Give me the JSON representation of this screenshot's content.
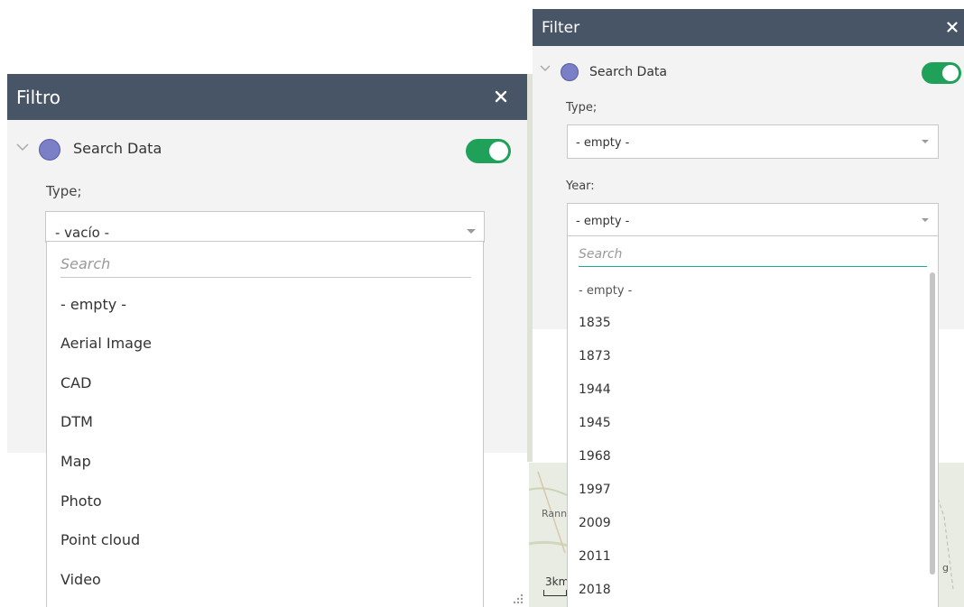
{
  "left_widget": {
    "title": "Filtro",
    "layer": {
      "name": "Search Data",
      "enabled": true
    },
    "field_label": "Type;",
    "select_value": "- vacío -",
    "dropdown": {
      "search_placeholder": "Search",
      "options": [
        "- empty -",
        "Aerial Image",
        "CAD",
        "DTM",
        "Map",
        "Photo",
        "Point cloud",
        "Video"
      ]
    }
  },
  "right_widget": {
    "title": "Filter",
    "layer": {
      "name": "Search Data",
      "enabled": true
    },
    "type_label": "Type;",
    "type_value": "- empty -",
    "year_label": "Year:",
    "year_value": "- empty -",
    "dropdown": {
      "search_placeholder": "Search",
      "options": [
        "- empty -",
        "1835",
        "1873",
        "1944",
        "1945",
        "1968",
        "1997",
        "2009",
        "2011",
        "2018"
      ]
    }
  },
  "map": {
    "scale_label": "3km",
    "place_label": "Rann",
    "edge_label": "g"
  },
  "colors": {
    "header": "#485566",
    "panel_bg": "#f3f3f3",
    "toggle_on": "#20a15a",
    "layer_dot": "#7b7fc6",
    "search_focus_underline": "#1aa99a"
  },
  "icons": {
    "close": "close-icon",
    "collapse": "chevron-down-icon",
    "layer": "layer-symbol-icon",
    "dropdown": "caret-down-icon"
  }
}
